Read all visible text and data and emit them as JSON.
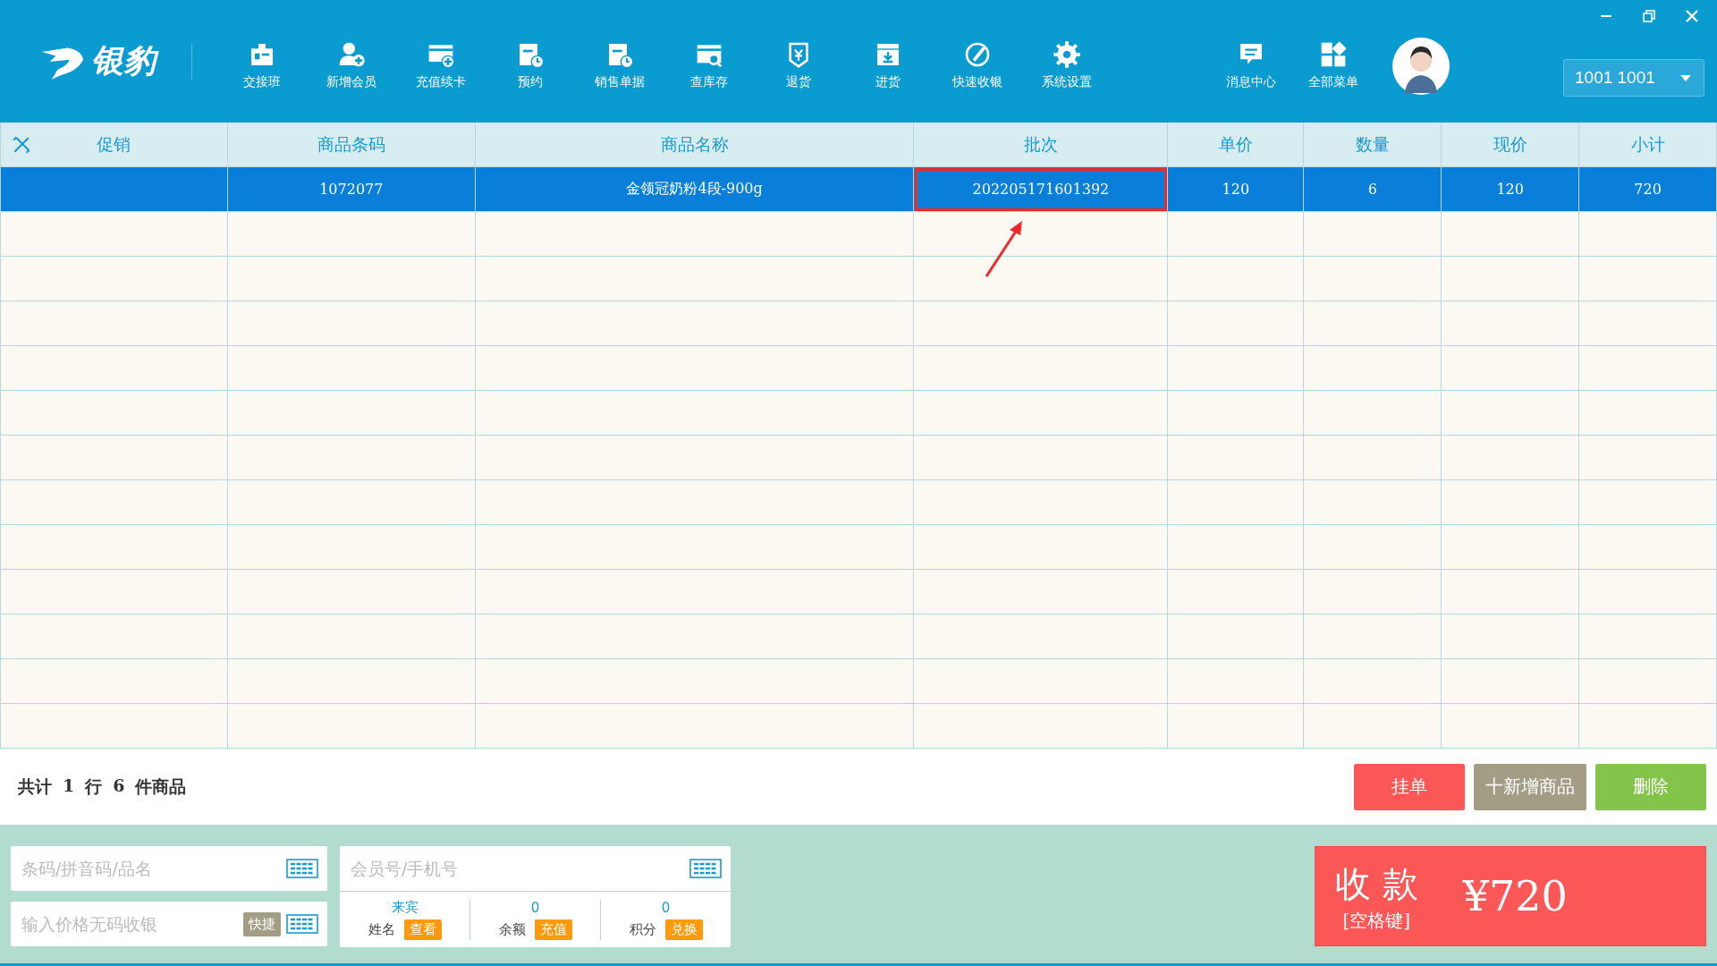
{
  "logo": {
    "text": "银豹"
  },
  "toolbar": [
    {
      "label": "交接班"
    },
    {
      "label": "新增会员"
    },
    {
      "label": "充值续卡"
    },
    {
      "label": "预约"
    },
    {
      "label": "销售单据"
    },
    {
      "label": "查库存"
    },
    {
      "label": "退货"
    },
    {
      "label": "进货"
    },
    {
      "label": "快速收银"
    },
    {
      "label": "系统设置"
    }
  ],
  "toolbar_right": [
    {
      "label": "消息中心"
    },
    {
      "label": "全部菜单"
    }
  ],
  "user_select": {
    "value": "1001 1001"
  },
  "table": {
    "columns": [
      "促销",
      "商品条码",
      "商品名称",
      "批次",
      "单价",
      "数量",
      "现价",
      "小计"
    ],
    "rows": [
      {
        "selected": true,
        "cells": [
          {
            "text": "",
            "highlighted": false
          },
          {
            "text": "1072077",
            "highlighted": false
          },
          {
            "text": "金领冠奶粉4段-900g",
            "highlighted": false
          },
          {
            "text": "202205171601392",
            "highlighted": true
          },
          {
            "text": "120",
            "highlighted": false
          },
          {
            "text": "6",
            "highlighted": false
          },
          {
            "text": "120",
            "highlighted": false
          },
          {
            "text": "720",
            "highlighted": false
          }
        ]
      }
    ]
  },
  "summary": {
    "parts": [
      "共计",
      "1",
      "行",
      "6",
      "件商品"
    ]
  },
  "actions": [
    {
      "label": "挂单",
      "kind": "hold"
    },
    {
      "label": "十新增商品",
      "kind": "add"
    },
    {
      "label": "删除",
      "kind": "delete"
    }
  ],
  "search_field": {
    "placeholder": "条码/拼音码/品名"
  },
  "price_field": {
    "placeholder": "输入价格无码收银",
    "shortcut": "快捷"
  },
  "member": {
    "placeholder": "会员号/手机号",
    "stats": [
      {
        "value": "来宾",
        "label": "姓名",
        "action": "查看"
      },
      {
        "value": "0",
        "label": "余额",
        "action": "充值"
      },
      {
        "value": "0",
        "label": "积分",
        "action": "兑换"
      }
    ]
  },
  "pay": {
    "title": "收 款",
    "hint": "[空格键]",
    "amount": "¥720"
  }
}
